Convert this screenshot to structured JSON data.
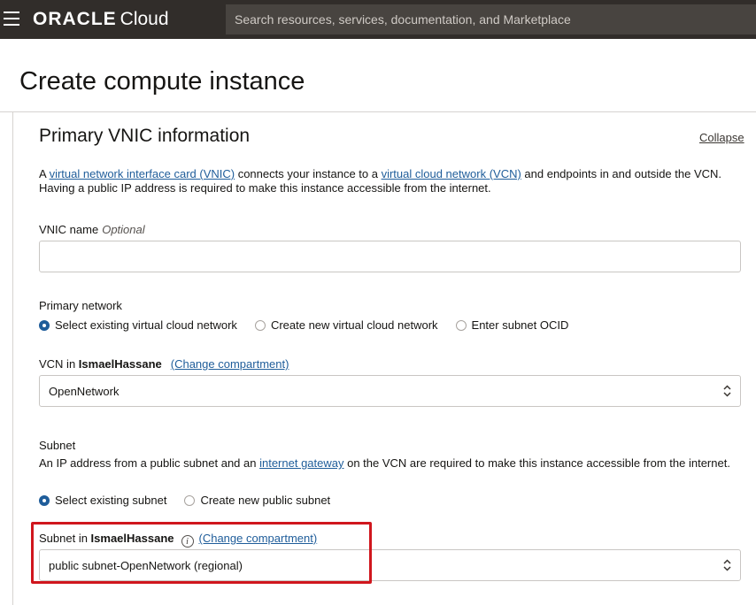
{
  "header": {
    "brand_main": "ORACLE",
    "brand_sub": "Cloud",
    "search_placeholder": "Search resources, services, documentation, and Marketplace"
  },
  "page": {
    "title": "Create compute instance"
  },
  "section": {
    "title": "Primary VNIC information",
    "collapse": "Collapse",
    "description": {
      "t1": "A ",
      "link1": "virtual network interface card (VNIC)",
      "t2": " connects your instance to a ",
      "link2": "virtual cloud network (VCN)",
      "t3": " and endpoints in and outside the VCN. Having a public IP address is required to make this instance accessible from the internet."
    }
  },
  "vnic_name": {
    "label": "VNIC name",
    "optional": "Optional",
    "value": ""
  },
  "primary_network": {
    "label": "Primary network",
    "options": [
      {
        "label": "Select existing virtual cloud network",
        "selected": true
      },
      {
        "label": "Create new virtual cloud network",
        "selected": false
      },
      {
        "label": "Enter subnet OCID",
        "selected": false
      }
    ]
  },
  "vcn": {
    "label_prefix": "VCN in ",
    "compartment": "IsmaelHassane",
    "change_link": "(Change compartment)",
    "selected": "OpenNetwork"
  },
  "subnet": {
    "label": "Subnet",
    "desc_t1": "An IP address from a public subnet and an ",
    "desc_link": "internet gateway",
    "desc_t2": " on the VCN are required to make this instance accessible from the internet.",
    "options": [
      {
        "label": "Select existing subnet",
        "selected": true
      },
      {
        "label": "Create new public subnet",
        "selected": false
      }
    ]
  },
  "subnet_select": {
    "label_prefix": "Subnet in ",
    "compartment": "IsmaelHassane",
    "change_link": "(Change compartment)",
    "info_icon": "info-icon",
    "selected": "public subnet-OpenNetwork (regional)"
  },
  "colors": {
    "topbar": "#312d2a",
    "link": "#1f5d9a",
    "highlight": "#d0161d"
  }
}
